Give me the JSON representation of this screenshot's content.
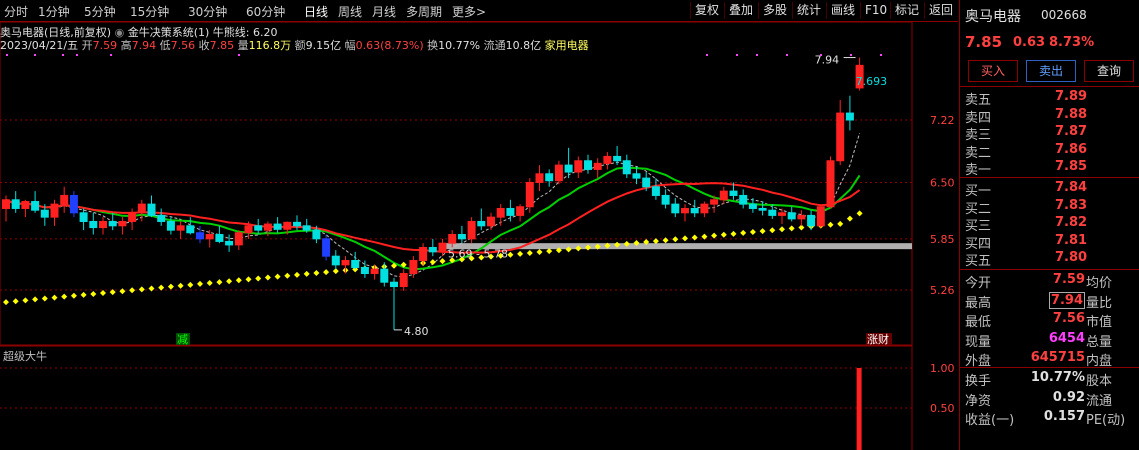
{
  "toolbar": {
    "periods": [
      "分时",
      "1分钟",
      "5分钟",
      "15分钟",
      "30分钟",
      "60分钟",
      "日线",
      "周线",
      "月线",
      "多周期",
      "更多>"
    ],
    "active": "日线",
    "right": [
      "复权",
      "叠加",
      "多股",
      "统计",
      "画线",
      "F10",
      "标记",
      "返回"
    ]
  },
  "info": {
    "name": "奥马电器(日线,前复权)",
    "date": "2023/04/21/五",
    "open_label": "开",
    "open": "7.59",
    "high_label": "高",
    "high": "7.94",
    "low_label": "低",
    "low": "7.56",
    "close_label": "收",
    "close": "7.85",
    "vol_label": "量",
    "vol": "116.8万",
    "amt_label": "额",
    "amt": "9.15亿",
    "amp_label": "幅",
    "amp": "0.63(8.73%)",
    "turn_label": "换",
    "turn": "10.77%",
    "float_label": "流通",
    "float": "10.8亿",
    "industry": "家用电器"
  },
  "indicator": {
    "name": "金牛决策系统(1)",
    "line_label": "牛熊线:",
    "line_value": "6.20"
  },
  "sub_panel": {
    "name": "超级大牛"
  },
  "chart_data": {
    "type": "candlestick",
    "price_ticks": [
      "7.22",
      "6.50",
      "5.85",
      "5.26"
    ],
    "price_tick_values": [
      7.22,
      6.5,
      5.85,
      5.26
    ],
    "sub_ticks": [
      "1.00",
      "0.50"
    ],
    "annotations": {
      "high_label": "7.94",
      "close_label": "7.693",
      "low_label": "4.80",
      "range_label": "5.69 - 5.78",
      "tag_reduce": "减",
      "tag_rise": "涨财"
    },
    "candles": [
      [
        6.2,
        6.35,
        6.05,
        6.3
      ],
      [
        6.3,
        6.4,
        6.15,
        6.2
      ],
      [
        6.2,
        6.3,
        6.1,
        6.28
      ],
      [
        6.28,
        6.4,
        6.15,
        6.18
      ],
      [
        6.18,
        6.25,
        6.0,
        6.1
      ],
      [
        6.1,
        6.3,
        6.0,
        6.25
      ],
      [
        6.25,
        6.45,
        6.15,
        6.35
      ],
      [
        6.35,
        6.4,
        6.1,
        6.15
      ],
      [
        6.15,
        6.2,
        5.95,
        6.05
      ],
      [
        6.05,
        6.15,
        5.9,
        5.98
      ],
      [
        5.98,
        6.1,
        5.9,
        6.05
      ],
      [
        6.05,
        6.15,
        5.95,
        6.0
      ],
      [
        6.0,
        6.1,
        5.9,
        6.05
      ],
      [
        6.05,
        6.2,
        5.95,
        6.15
      ],
      [
        6.15,
        6.3,
        6.05,
        6.25
      ],
      [
        6.25,
        6.35,
        6.1,
        6.12
      ],
      [
        6.12,
        6.2,
        6.0,
        6.05
      ],
      [
        6.05,
        6.1,
        5.9,
        5.95
      ],
      [
        5.95,
        6.05,
        5.85,
        6.0
      ],
      [
        6.0,
        6.1,
        5.9,
        5.92
      ],
      [
        5.92,
        6.0,
        5.8,
        5.85
      ],
      [
        5.85,
        5.95,
        5.75,
        5.9
      ],
      [
        5.9,
        6.0,
        5.8,
        5.82
      ],
      [
        5.82,
        5.9,
        5.7,
        5.78
      ],
      [
        5.78,
        5.95,
        5.72,
        5.92
      ],
      [
        5.92,
        6.05,
        5.85,
        6.0
      ],
      [
        6.0,
        6.08,
        5.9,
        5.95
      ],
      [
        5.95,
        6.05,
        5.88,
        6.02
      ],
      [
        6.02,
        6.1,
        5.92,
        5.96
      ],
      [
        5.96,
        6.05,
        5.9,
        6.04
      ],
      [
        6.04,
        6.12,
        5.95,
        6.0
      ],
      [
        6.0,
        6.08,
        5.92,
        5.95
      ],
      [
        5.95,
        6.0,
        5.8,
        5.85
      ],
      [
        5.85,
        5.9,
        5.6,
        5.65
      ],
      [
        5.65,
        5.72,
        5.5,
        5.55
      ],
      [
        5.55,
        5.65,
        5.45,
        5.6
      ],
      [
        5.6,
        5.7,
        5.5,
        5.52
      ],
      [
        5.52,
        5.6,
        5.4,
        5.45
      ],
      [
        5.45,
        5.55,
        5.38,
        5.5
      ],
      [
        5.5,
        5.58,
        5.3,
        5.35
      ],
      [
        5.35,
        5.4,
        4.8,
        5.3
      ],
      [
        5.3,
        5.5,
        5.25,
        5.45
      ],
      [
        5.45,
        5.65,
        5.4,
        5.6
      ],
      [
        5.6,
        5.8,
        5.55,
        5.75
      ],
      [
        5.75,
        5.85,
        5.65,
        5.7
      ],
      [
        5.7,
        5.85,
        5.65,
        5.8
      ],
      [
        5.8,
        5.95,
        5.75,
        5.9
      ],
      [
        5.9,
        6.0,
        5.8,
        5.85
      ],
      [
        5.85,
        6.1,
        5.8,
        6.05
      ],
      [
        6.05,
        6.2,
        5.95,
        6.0
      ],
      [
        6.0,
        6.15,
        5.95,
        6.1
      ],
      [
        6.1,
        6.25,
        6.0,
        6.2
      ],
      [
        6.2,
        6.3,
        6.05,
        6.12
      ],
      [
        6.12,
        6.25,
        6.05,
        6.22
      ],
      [
        6.22,
        6.55,
        6.15,
        6.5
      ],
      [
        6.5,
        6.7,
        6.4,
        6.6
      ],
      [
        6.6,
        6.65,
        6.45,
        6.52
      ],
      [
        6.52,
        6.75,
        6.48,
        6.7
      ],
      [
        6.7,
        6.9,
        6.55,
        6.62
      ],
      [
        6.62,
        6.8,
        6.55,
        6.75
      ],
      [
        6.75,
        6.82,
        6.6,
        6.65
      ],
      [
        6.65,
        6.78,
        6.55,
        6.72
      ],
      [
        6.72,
        6.85,
        6.65,
        6.8
      ],
      [
        6.8,
        6.92,
        6.7,
        6.75
      ],
      [
        6.75,
        6.82,
        6.55,
        6.6
      ],
      [
        6.6,
        6.68,
        6.48,
        6.55
      ],
      [
        6.55,
        6.62,
        6.4,
        6.45
      ],
      [
        6.45,
        6.55,
        6.3,
        6.35
      ],
      [
        6.35,
        6.42,
        6.2,
        6.25
      ],
      [
        6.25,
        6.32,
        6.1,
        6.15
      ],
      [
        6.15,
        6.25,
        6.05,
        6.2
      ],
      [
        6.2,
        6.3,
        6.1,
        6.15
      ],
      [
        6.15,
        6.28,
        6.1,
        6.25
      ],
      [
        6.25,
        6.35,
        6.15,
        6.3
      ],
      [
        6.3,
        6.45,
        6.25,
        6.4
      ],
      [
        6.4,
        6.5,
        6.3,
        6.35
      ],
      [
        6.35,
        6.42,
        6.2,
        6.25
      ],
      [
        6.25,
        6.32,
        6.15,
        6.2
      ],
      [
        6.2,
        6.28,
        6.12,
        6.18
      ],
      [
        6.18,
        6.25,
        6.08,
        6.12
      ],
      [
        6.12,
        6.2,
        6.02,
        6.15
      ],
      [
        6.15,
        6.22,
        6.05,
        6.08
      ],
      [
        6.08,
        6.18,
        6.0,
        6.12
      ],
      [
        6.12,
        6.18,
        5.95,
        6.0
      ],
      [
        6.0,
        6.25,
        5.98,
        6.22
      ],
      [
        6.22,
        6.8,
        6.2,
        6.75
      ],
      [
        6.75,
        7.45,
        6.7,
        7.3
      ],
      [
        7.3,
        7.5,
        7.1,
        7.22
      ],
      [
        7.59,
        7.94,
        7.56,
        7.85
      ]
    ],
    "volume_last": 1.0
  },
  "quote": {
    "name": "奥马电器",
    "code": "002668",
    "price": "7.85",
    "change": "0.63",
    "change_pct": "8.73%",
    "buy_btn": "买入",
    "sell_btn": "卖出",
    "query_btn": "查询",
    "asks": [
      {
        "label": "卖五",
        "price": "7.89"
      },
      {
        "label": "卖四",
        "price": "7.88"
      },
      {
        "label": "卖三",
        "price": "7.87"
      },
      {
        "label": "卖二",
        "price": "7.86"
      },
      {
        "label": "卖一",
        "price": "7.85"
      }
    ],
    "bids": [
      {
        "label": "买一",
        "price": "7.84"
      },
      {
        "label": "买二",
        "price": "7.83"
      },
      {
        "label": "买三",
        "price": "7.82"
      },
      {
        "label": "买四",
        "price": "7.81"
      },
      {
        "label": "买五",
        "price": "7.80"
      }
    ],
    "stats": [
      {
        "l1": "今开",
        "v": "7.59",
        "c": "#ff4040",
        "l2": "均价"
      },
      {
        "l1": "最高",
        "v": "7.94",
        "c": "#ff4040",
        "l2": "量比",
        "boxed": true
      },
      {
        "l1": "最低",
        "v": "7.56",
        "c": "#ff4040",
        "l2": "市值"
      },
      {
        "l1": "现量",
        "v": "6454",
        "c": "#ff40ff",
        "l2": "总量"
      },
      {
        "l1": "外盘",
        "v": "645715",
        "c": "#ff4040",
        "l2": "内盘"
      }
    ],
    "stats2": [
      {
        "l1": "换手",
        "v": "10.77%",
        "c": "#e0e0e0",
        "l2": "股本"
      },
      {
        "l1": "净资",
        "v": "0.92",
        "c": "#e0e0e0",
        "l2": "流通"
      },
      {
        "l1": "收益(一)",
        "v": "0.157",
        "c": "#e0e0e0",
        "l2": "PE(动)"
      }
    ]
  },
  "colors": {
    "up": "#ff2020",
    "down": "#00e0e0",
    "bull_line": "#ffff00",
    "ma_red": "#ff2020",
    "ma_green": "#00d000"
  }
}
